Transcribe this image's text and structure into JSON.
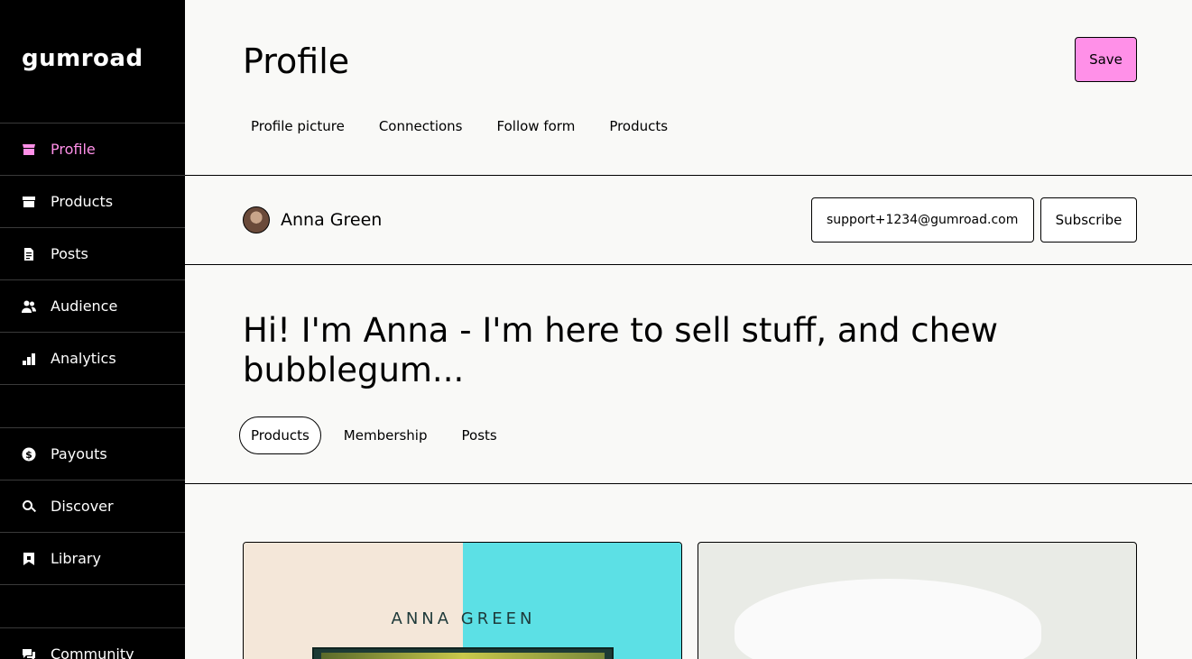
{
  "sidebar": {
    "logo": "gumroad",
    "items": [
      {
        "label": "Profile",
        "icon": "store-icon",
        "active": true
      },
      {
        "label": "Products",
        "icon": "archive-icon"
      },
      {
        "label": "Posts",
        "icon": "document-icon"
      },
      {
        "label": "Audience",
        "icon": "people-icon"
      },
      {
        "label": "Analytics",
        "icon": "bar-chart-icon"
      },
      {
        "label": "Payouts",
        "icon": "dollar-circle-icon"
      },
      {
        "label": "Discover",
        "icon": "search-icon"
      },
      {
        "label": "Library",
        "icon": "bookmark-icon"
      },
      {
        "label": "Community",
        "icon": "chat-icon"
      }
    ]
  },
  "header": {
    "title": "Profile",
    "save_label": "Save",
    "tabs": [
      "Profile picture",
      "Connections",
      "Follow form",
      "Products"
    ]
  },
  "profile": {
    "name": "Anna Green",
    "email_value": "support+1234@gumroad.com",
    "subscribe_label": "Subscribe",
    "bio": "Hi! I'm Anna - I'm here to sell stuff, and chew bubblegum...",
    "section_tabs": [
      "Products",
      "Membership",
      "Posts"
    ],
    "active_section": "Products"
  },
  "products": {
    "card1_title": "ANNA GREEN"
  },
  "colors": {
    "accent": "#ff90e8",
    "sidebar_bg": "#000000",
    "page_bg": "#f9f9f7",
    "card_teal": "#5ce0e5",
    "card_cream": "#f4e7d9"
  }
}
